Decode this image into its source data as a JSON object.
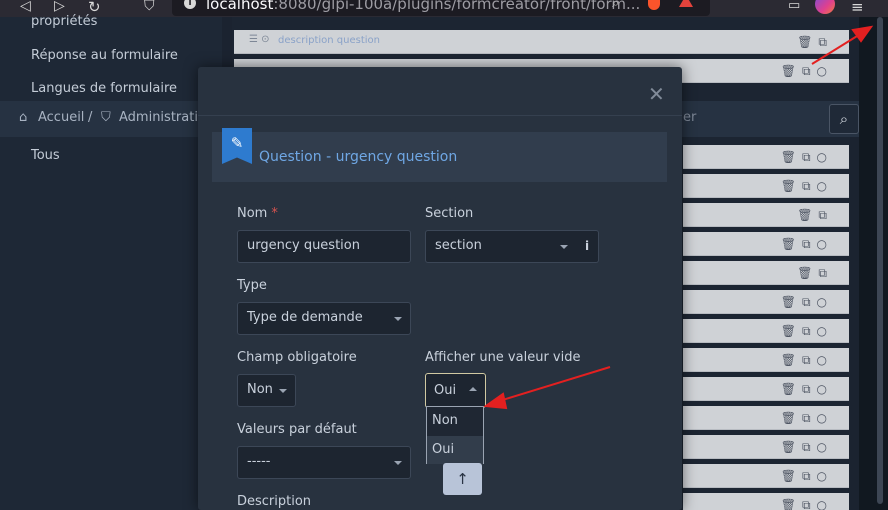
{
  "browser": {
    "url_host": "localhost",
    "url_rest": ":8080/glpi-100a/plugins/formcreator/front/form..."
  },
  "sidebar": {
    "items": [
      {
        "label": "propriétés"
      },
      {
        "label": "Réponse au formulaire"
      },
      {
        "label": "Langues de formulaire"
      },
      {
        "label": "Tous"
      }
    ]
  },
  "breadcrumb": {
    "home": "Accueil",
    "separator": "/",
    "admin": "Administration"
  },
  "search": {
    "placeholder_fragment": "er"
  },
  "question_list": {
    "description_row_label": "description question"
  },
  "modal": {
    "title": "Question - urgency question",
    "fields": {
      "name": {
        "label": "Nom",
        "required_mark": "*",
        "value": "urgency question"
      },
      "section": {
        "label": "Section",
        "value": "section",
        "info_label": "i"
      },
      "type": {
        "label": "Type",
        "value": "Type de demande"
      },
      "mandatory": {
        "label": "Champ obligatoire",
        "value": "Non"
      },
      "show_empty": {
        "label": "Afficher une valeur vide",
        "value": "Oui",
        "options": [
          "Non",
          "Oui"
        ]
      },
      "default_values": {
        "label": "Valeurs par défaut",
        "value": "-----"
      },
      "description": {
        "label": "Description"
      }
    }
  },
  "colors": {
    "accent": "#6fa7e4",
    "ribbon": "#2e7bcf",
    "annotation_arrow": "#e32020"
  }
}
